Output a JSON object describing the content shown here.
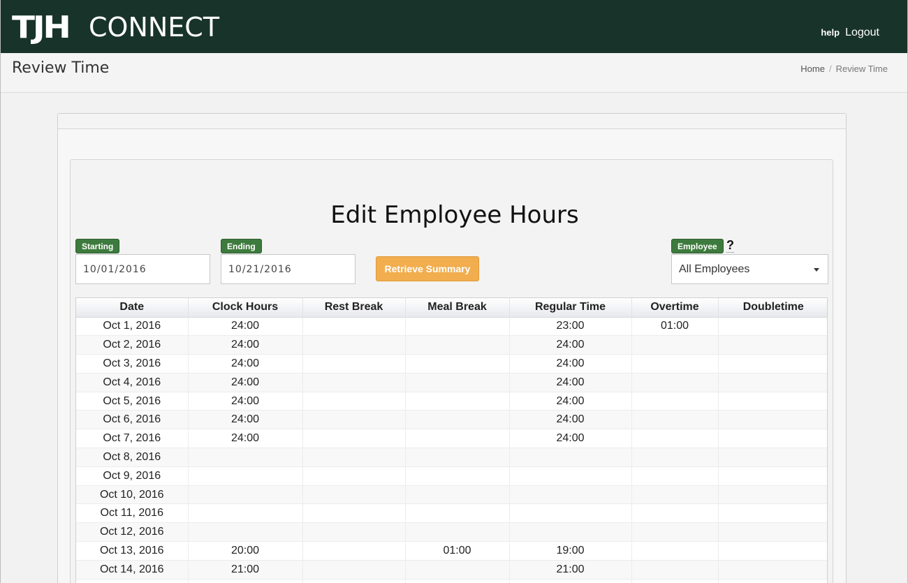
{
  "header": {
    "logo_bold": "TJH",
    "logo_thin": "CONNECT",
    "help_label": "help",
    "logout_label": "Logout"
  },
  "titlebar": {
    "title": "Review Time",
    "breadcrumb": {
      "home": "Home",
      "separator": "/",
      "current": "Review Time"
    }
  },
  "form": {
    "title": "Edit Employee Hours",
    "starting_label": "Starting",
    "starting_value": "10/01/2016",
    "ending_label": "Ending",
    "ending_value": "10/21/2016",
    "retrieve_label": "Retrieve Summary",
    "employee_label": "Employee",
    "help_mark": "?",
    "employee_value": "All Employees"
  },
  "table": {
    "columns": [
      "Date",
      "Clock Hours",
      "Rest Break",
      "Meal Break",
      "Regular Time",
      "Overtime",
      "Doubletime"
    ],
    "rows": [
      [
        "Oct 1, 2016",
        "24:00",
        "",
        "",
        "23:00",
        "01:00",
        ""
      ],
      [
        "Oct 2, 2016",
        "24:00",
        "",
        "",
        "24:00",
        "",
        ""
      ],
      [
        "Oct 3, 2016",
        "24:00",
        "",
        "",
        "24:00",
        "",
        ""
      ],
      [
        "Oct 4, 2016",
        "24:00",
        "",
        "",
        "24:00",
        "",
        ""
      ],
      [
        "Oct 5, 2016",
        "24:00",
        "",
        "",
        "24:00",
        "",
        ""
      ],
      [
        "Oct 6, 2016",
        "24:00",
        "",
        "",
        "24:00",
        "",
        ""
      ],
      [
        "Oct 7, 2016",
        "24:00",
        "",
        "",
        "24:00",
        "",
        ""
      ],
      [
        "Oct 8, 2016",
        "",
        "",
        "",
        "",
        "",
        ""
      ],
      [
        "Oct 9, 2016",
        "",
        "",
        "",
        "",
        "",
        ""
      ],
      [
        "Oct 10, 2016",
        "",
        "",
        "",
        "",
        "",
        ""
      ],
      [
        "Oct 11, 2016",
        "",
        "",
        "",
        "",
        "",
        ""
      ],
      [
        "Oct 12, 2016",
        "",
        "",
        "",
        "",
        "",
        ""
      ],
      [
        "Oct 13, 2016",
        "20:00",
        "",
        "01:00",
        "19:00",
        "",
        ""
      ],
      [
        "Oct 14, 2016",
        "21:00",
        "",
        "",
        "21:00",
        "",
        ""
      ],
      [
        "",
        "",
        "",
        "",
        "",
        "",
        ""
      ]
    ]
  },
  "colors": {
    "topbar": "#18332a",
    "tag_green": "#3d7a3d",
    "retrieve_orange": "#f2ad4e"
  }
}
